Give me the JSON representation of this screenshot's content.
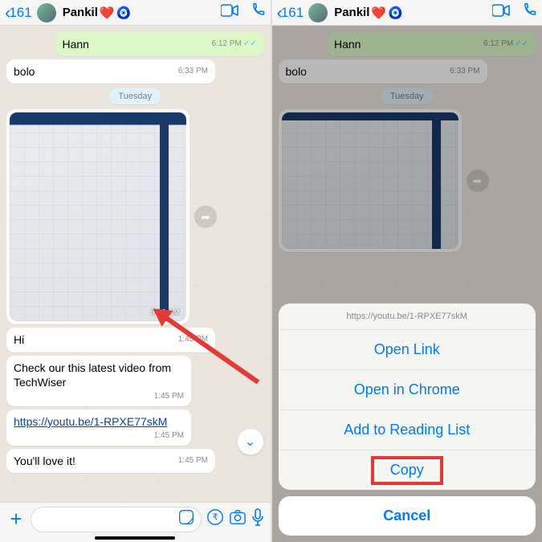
{
  "header": {
    "back_count": "161",
    "contact_name": "Pankil",
    "heart": "❤️",
    "eye": "🧿"
  },
  "chat": {
    "out_msg": "Hann",
    "out_time": "6:12 PM",
    "in_bolo": "bolo",
    "in_bolo_time": "6:33 PM",
    "date_label": "Tuesday",
    "photo_time": "3:10 AM",
    "hi": "Hi",
    "hi_time": "1:45 PM",
    "check": "Check our this latest video from TechWiser",
    "check_time": "1:45 PM",
    "link": "https://youtu.be/1-RPXE77skM",
    "link_time": "1:45 PM",
    "love": "You'll love it!",
    "love_time": "1:45 PM"
  },
  "sheet": {
    "url": "https://youtu.be/1-RPXE77skM",
    "open_link": "Open Link",
    "open_chrome": "Open in Chrome",
    "reading_list": "Add to Reading List",
    "copy": "Copy",
    "cancel": "Cancel"
  }
}
